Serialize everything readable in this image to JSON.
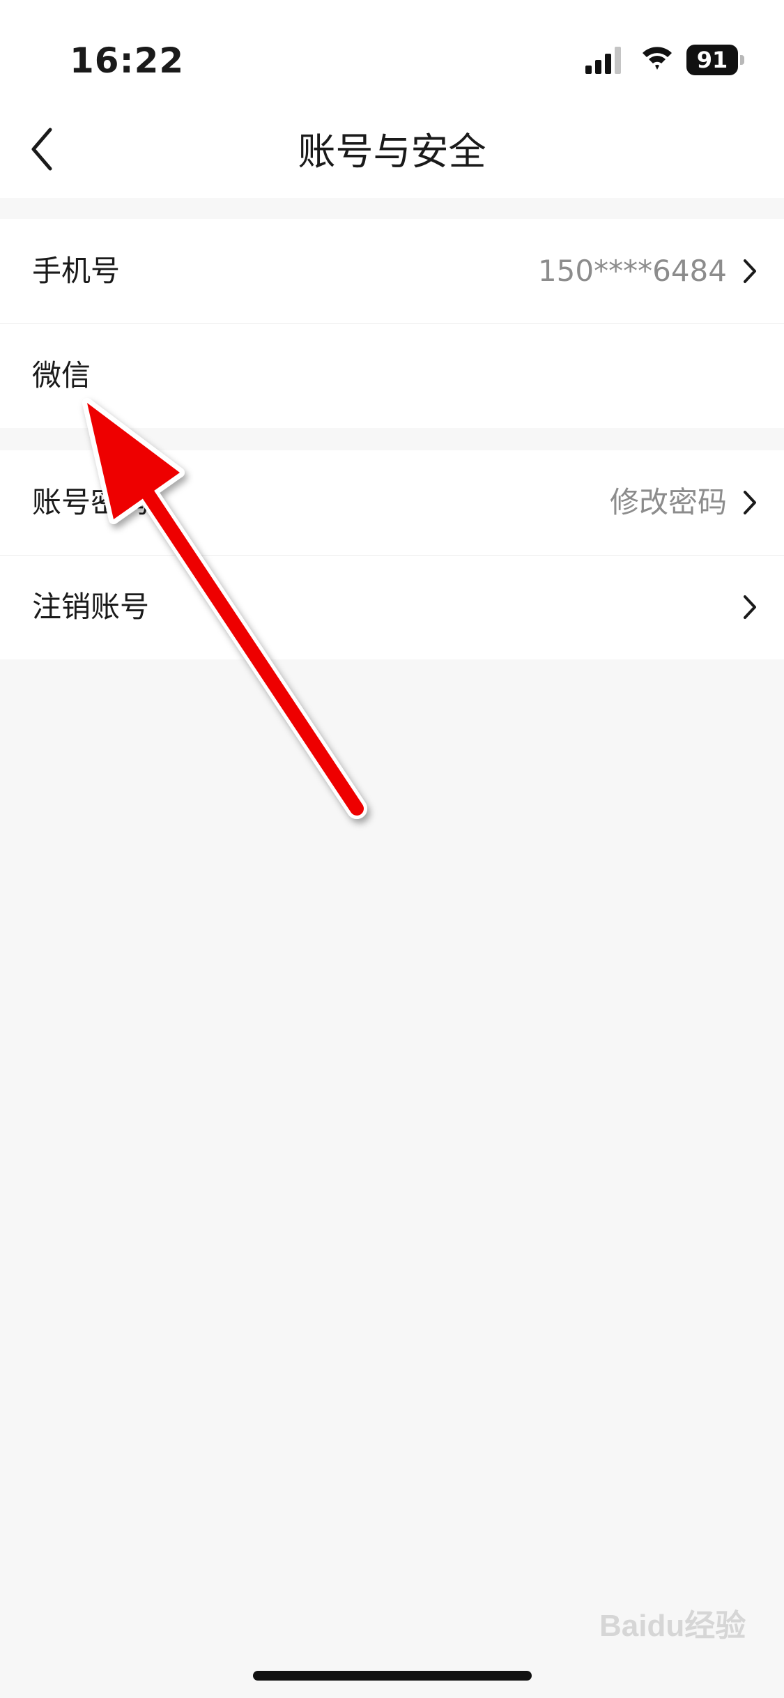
{
  "status_bar": {
    "time": "16:22",
    "battery_level": "91",
    "icons": [
      "signal-icon",
      "wifi-icon",
      "battery-icon"
    ]
  },
  "header": {
    "title": "账号与安全",
    "back_icon": "chevron-left-icon"
  },
  "sections": [
    {
      "items": [
        {
          "label": "手机号",
          "value": "150****6484",
          "has_chevron": true
        },
        {
          "label": "微信",
          "value": "",
          "has_chevron": false
        }
      ]
    },
    {
      "items": [
        {
          "label": "账号密码",
          "value": "修改密码",
          "has_chevron": true
        },
        {
          "label": "注销账号",
          "value": "",
          "has_chevron": true
        }
      ]
    }
  ],
  "annotation": {
    "type": "red-arrow",
    "color": "#ee0000",
    "points_to": "微信"
  },
  "watermark": {
    "text": "Baidu经验",
    "color": "#d6d6d6"
  },
  "colors": {
    "background": "#f7f7f7",
    "card": "#ffffff",
    "secondary_text": "#8c8c8c"
  }
}
